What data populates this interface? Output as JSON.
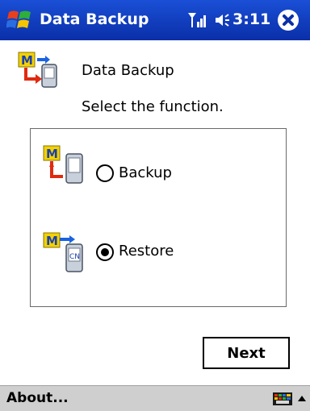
{
  "titlebar": {
    "title": "Data Backup",
    "time": "3:11",
    "icons": [
      "windows-start-icon",
      "signal-icon",
      "volume-icon",
      "close-icon"
    ],
    "color": "#0a2fa8"
  },
  "header": {
    "title": "Data Backup",
    "instruction": "Select the function."
  },
  "options": {
    "backup": {
      "label": "Backup",
      "selected": false
    },
    "restore": {
      "label": "Restore",
      "selected": true
    }
  },
  "next_button": {
    "label": "Next"
  },
  "menubar": {
    "about_label": "About...",
    "icons": [
      "keyboard-icon",
      "input-arrow-icon"
    ]
  }
}
